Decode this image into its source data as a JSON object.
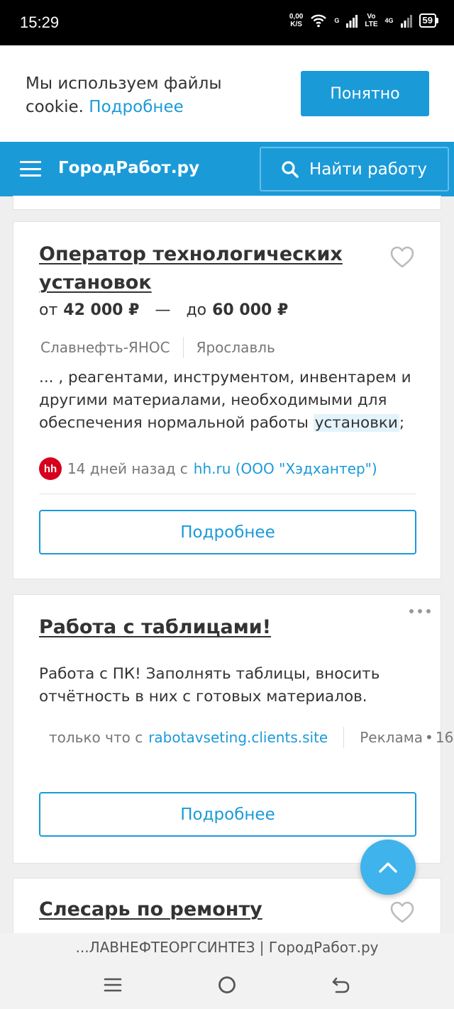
{
  "status_bar": {
    "time": "15:29",
    "net_speed_value": "0,00",
    "net_speed_unit": "K/S",
    "tag_1_top": "G",
    "tag_2_top": "Vo",
    "tag_2_bottom": "LTE",
    "tag_3": "4G",
    "battery": "59"
  },
  "cookie_bar": {
    "text": "Мы используем файлы cookie.",
    "link": "Подробнее",
    "accept_label": "Понятно"
  },
  "header": {
    "logo": "ГородРабот.ру",
    "search_label": "Найти работу"
  },
  "vacancy_1": {
    "title": "Оператор технологических установок",
    "salary_from_prefix": "от",
    "salary_from": "42 000 ₽",
    "salary_dash": "—",
    "salary_to_prefix": "до",
    "salary_to": "60 000 ₽",
    "company": "Славнефть-ЯНОС",
    "city": "Ярославль",
    "snippet_before": "... , реагентами, инструментом, инвентарем и другими материалами, необходимыми для обеспечения нормальной работы ",
    "snippet_highlight": "установки",
    "snippet_after": ";",
    "source_logo": "hh",
    "source_time": "14 дней назад с",
    "source_link": "hh.ru (ООО \"Хэдхантер\")",
    "more_label": "Подробнее"
  },
  "ad_card": {
    "title": "Работа с таблицами!",
    "text": "Работа с ПК! Заполнять таблицы, вносить отчётность в них с готовых материалов.",
    "source_time": "только что с",
    "source_link": "rabotavseting.clients.site",
    "ad_label": "Реклама",
    "ad_age": "16",
    "more_label": "Подробнее"
  },
  "vacancy_3": {
    "title": "Слесарь по ремонту"
  },
  "page_label": "...ЛАВНЕФТЕОРГСИНТЕЗ | ГородРабот.ру",
  "icons": {
    "menu": "hamburger-menu-icon",
    "search": "search-icon",
    "favorite": "heart-outline-icon",
    "more": "more-dots-icon",
    "scroll_up": "chevron-up-icon",
    "nav_recent": "recent-apps-icon",
    "nav_home": "home-circle-icon",
    "nav_back": "back-arrow-icon"
  },
  "colors": {
    "brand_blue": "#1b9ad8",
    "hh_red": "#d6001c",
    "status_bar_bg": "#000000"
  }
}
